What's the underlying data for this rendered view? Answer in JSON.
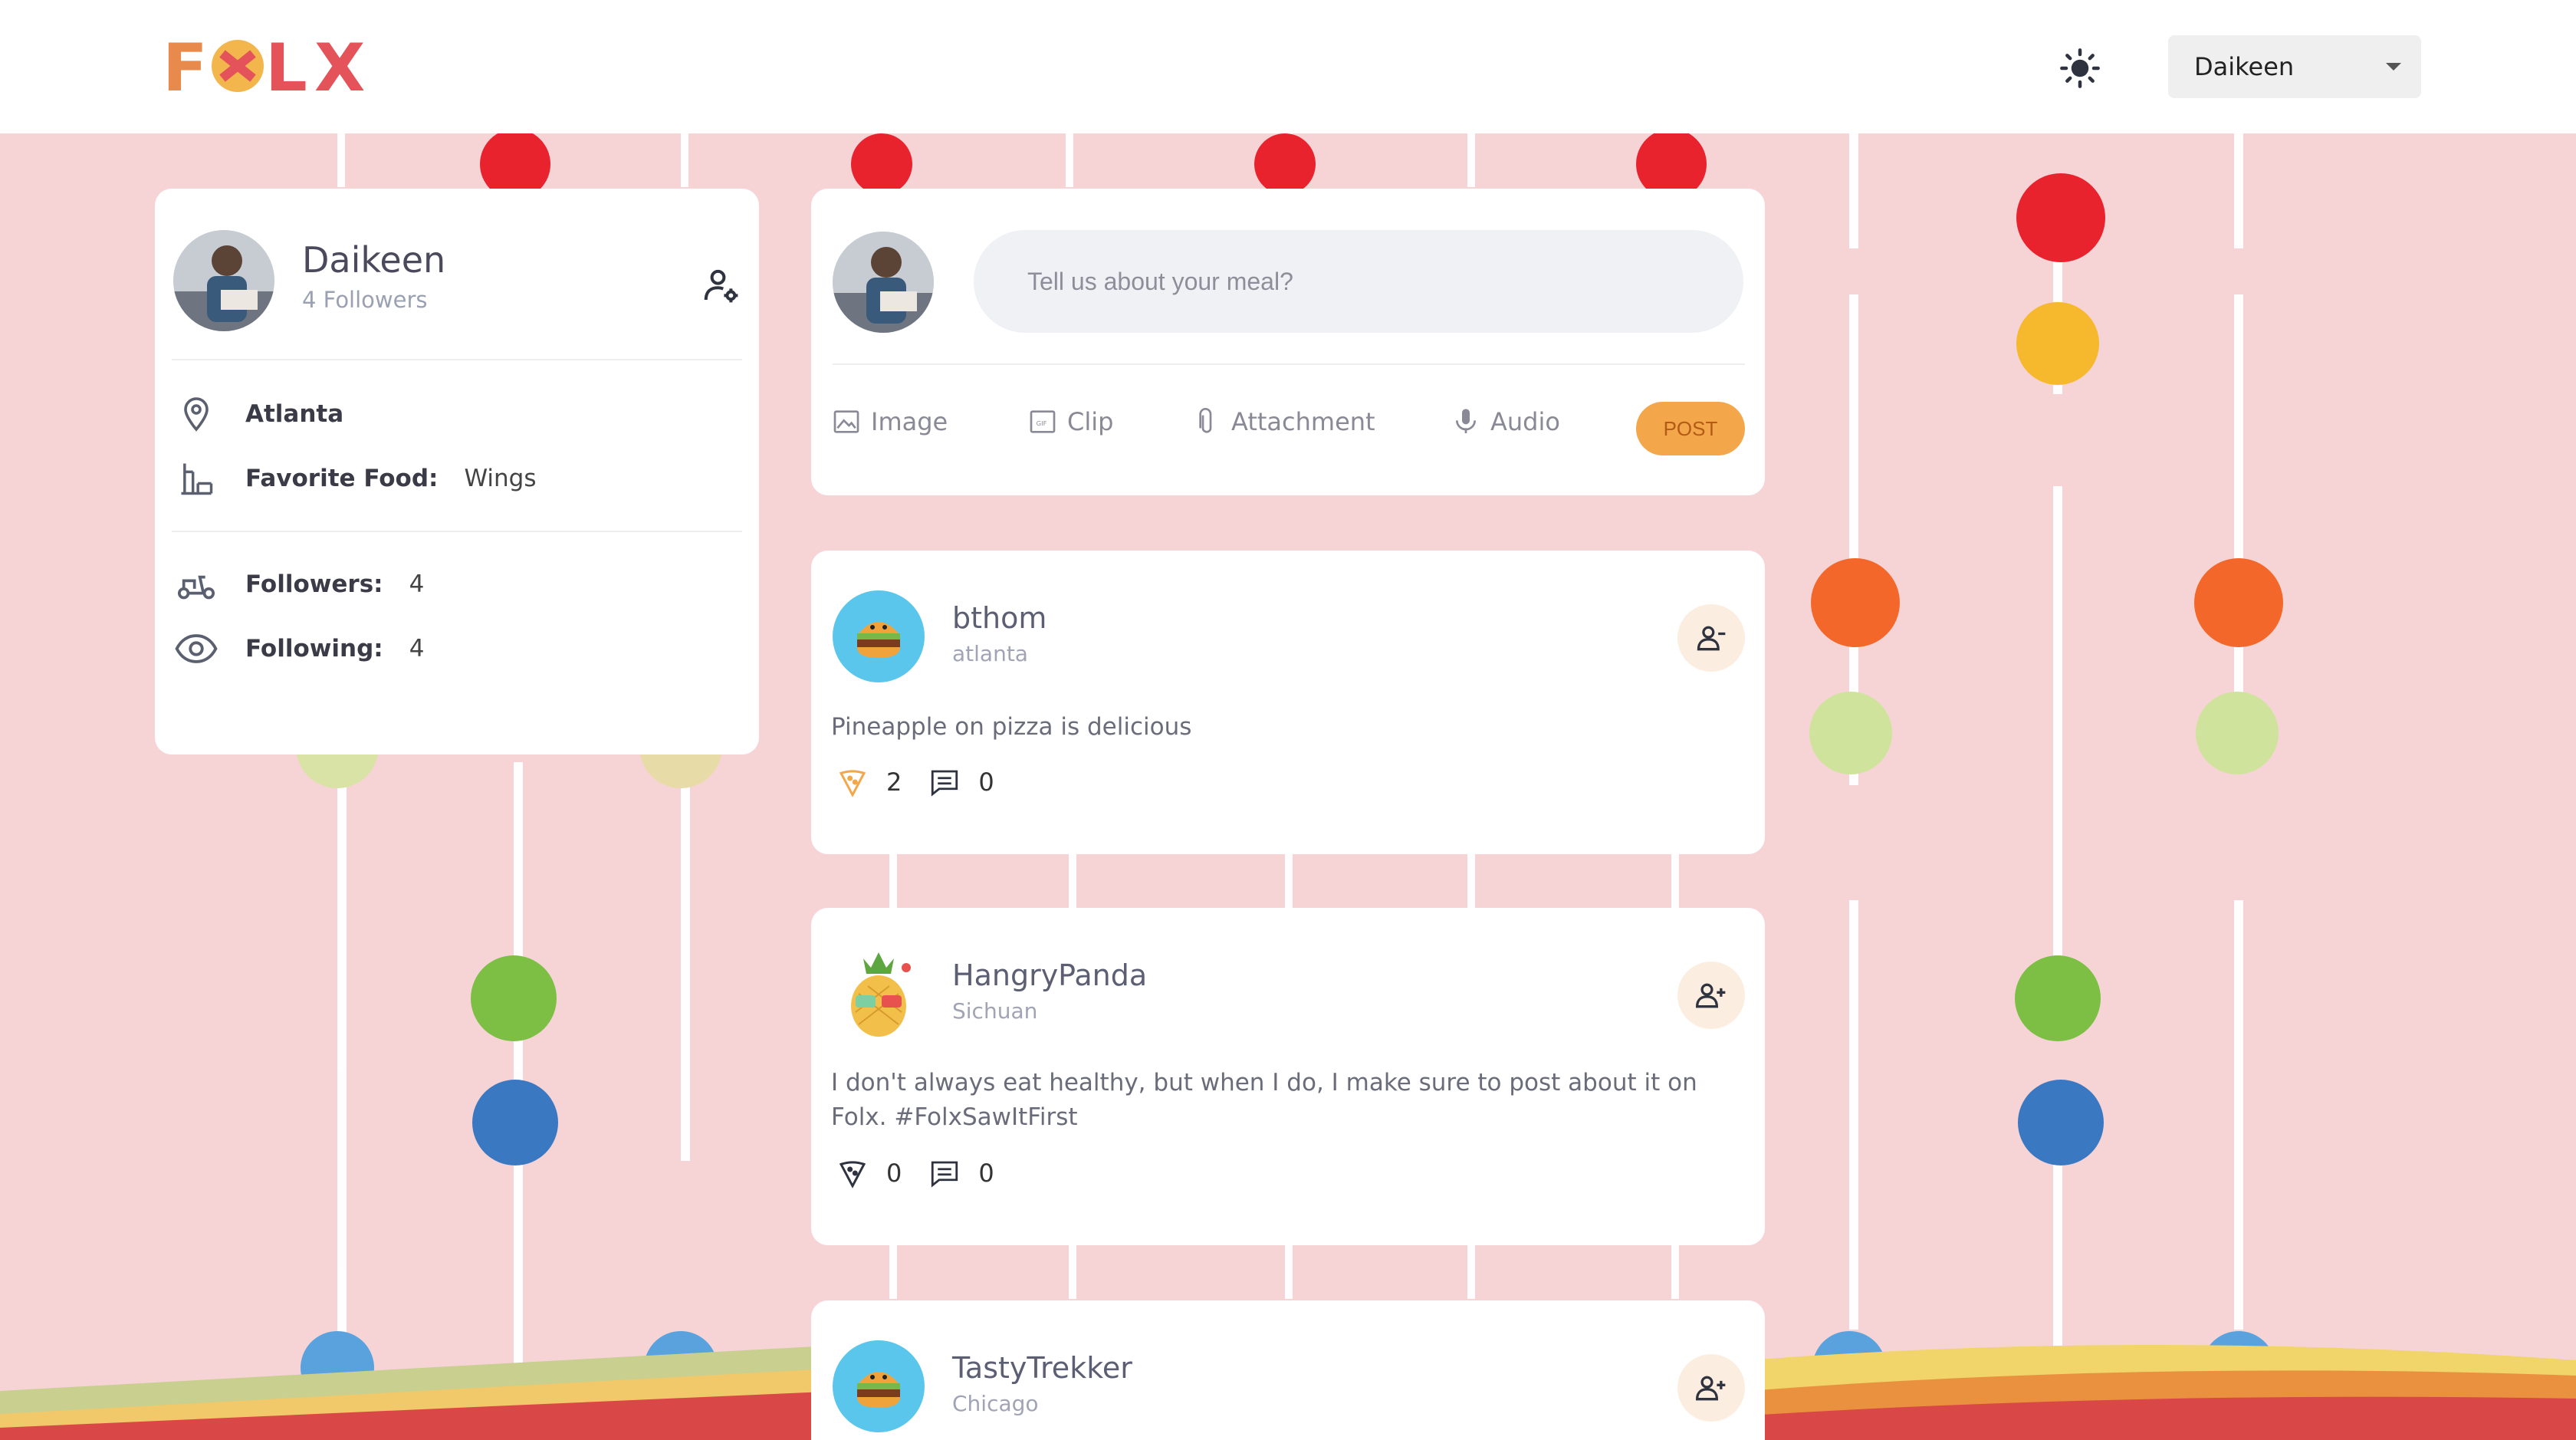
{
  "header": {
    "logo_text": "FOLX",
    "theme_toggle_icon": "sun-icon",
    "user_select_value": "Daikeen"
  },
  "profile": {
    "name": "Daikeen",
    "followers_summary": "4 Followers",
    "location": "Atlanta",
    "favorite_food_label": "Favorite Food:",
    "favorite_food": "Wings",
    "followers_label": "Followers:",
    "followers_count": "4",
    "following_label": "Following:",
    "following_count": "4"
  },
  "composer": {
    "placeholder": "Tell us about your meal?",
    "tools": [
      "Image",
      "Clip",
      "Attachment",
      "Audio"
    ],
    "post_label": "POST"
  },
  "posts": [
    {
      "username": "bthom",
      "location": "atlanta",
      "text": "Pineapple on pizza is delicious",
      "likes": "2",
      "comments": "0",
      "avatar": "burger-avatar",
      "follow_icon": "remove-user-icon"
    },
    {
      "username": "HangryPanda",
      "location": "Sichuan",
      "text": "I don't always eat healthy, but when I do, I make sure to post about it on Folx. #FolxSawItFirst",
      "likes": "0",
      "comments": "0",
      "avatar": "pineapple-avatar",
      "follow_icon": "add-user-icon"
    },
    {
      "username": "TastyTrekker",
      "location": "Chicago",
      "avatar": "burger-avatar",
      "follow_icon": "add-user-icon"
    }
  ],
  "colors": {
    "background": "#f6d4d6",
    "accent": "#f3a74a",
    "card": "#ffffff"
  }
}
